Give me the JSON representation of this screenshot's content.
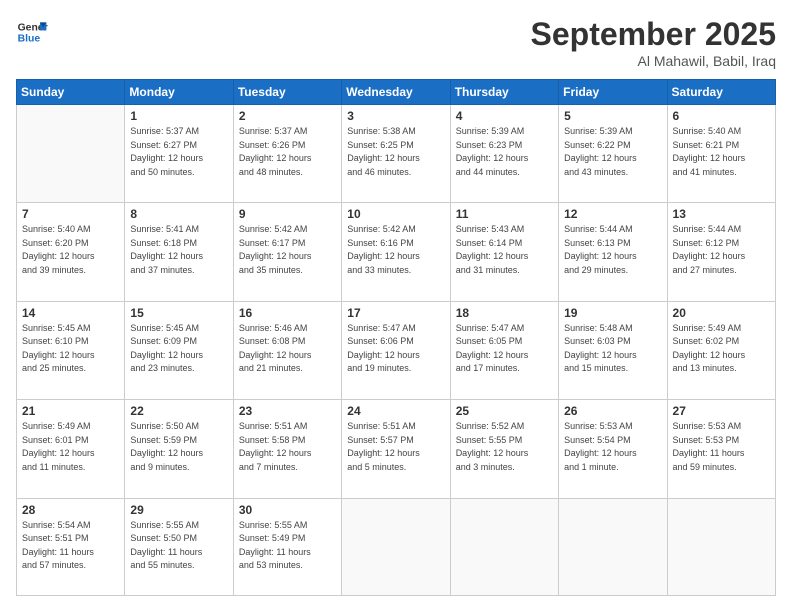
{
  "header": {
    "logo_line1": "General",
    "logo_line2": "Blue",
    "month_year": "September 2025",
    "location": "Al Mahawil, Babil, Iraq"
  },
  "weekdays": [
    "Sunday",
    "Monday",
    "Tuesday",
    "Wednesday",
    "Thursday",
    "Friday",
    "Saturday"
  ],
  "rows": [
    [
      {
        "day": "",
        "info": ""
      },
      {
        "day": "1",
        "info": "Sunrise: 5:37 AM\nSunset: 6:27 PM\nDaylight: 12 hours\nand 50 minutes."
      },
      {
        "day": "2",
        "info": "Sunrise: 5:37 AM\nSunset: 6:26 PM\nDaylight: 12 hours\nand 48 minutes."
      },
      {
        "day": "3",
        "info": "Sunrise: 5:38 AM\nSunset: 6:25 PM\nDaylight: 12 hours\nand 46 minutes."
      },
      {
        "day": "4",
        "info": "Sunrise: 5:39 AM\nSunset: 6:23 PM\nDaylight: 12 hours\nand 44 minutes."
      },
      {
        "day": "5",
        "info": "Sunrise: 5:39 AM\nSunset: 6:22 PM\nDaylight: 12 hours\nand 43 minutes."
      },
      {
        "day": "6",
        "info": "Sunrise: 5:40 AM\nSunset: 6:21 PM\nDaylight: 12 hours\nand 41 minutes."
      }
    ],
    [
      {
        "day": "7",
        "info": "Sunrise: 5:40 AM\nSunset: 6:20 PM\nDaylight: 12 hours\nand 39 minutes."
      },
      {
        "day": "8",
        "info": "Sunrise: 5:41 AM\nSunset: 6:18 PM\nDaylight: 12 hours\nand 37 minutes."
      },
      {
        "day": "9",
        "info": "Sunrise: 5:42 AM\nSunset: 6:17 PM\nDaylight: 12 hours\nand 35 minutes."
      },
      {
        "day": "10",
        "info": "Sunrise: 5:42 AM\nSunset: 6:16 PM\nDaylight: 12 hours\nand 33 minutes."
      },
      {
        "day": "11",
        "info": "Sunrise: 5:43 AM\nSunset: 6:14 PM\nDaylight: 12 hours\nand 31 minutes."
      },
      {
        "day": "12",
        "info": "Sunrise: 5:44 AM\nSunset: 6:13 PM\nDaylight: 12 hours\nand 29 minutes."
      },
      {
        "day": "13",
        "info": "Sunrise: 5:44 AM\nSunset: 6:12 PM\nDaylight: 12 hours\nand 27 minutes."
      }
    ],
    [
      {
        "day": "14",
        "info": "Sunrise: 5:45 AM\nSunset: 6:10 PM\nDaylight: 12 hours\nand 25 minutes."
      },
      {
        "day": "15",
        "info": "Sunrise: 5:45 AM\nSunset: 6:09 PM\nDaylight: 12 hours\nand 23 minutes."
      },
      {
        "day": "16",
        "info": "Sunrise: 5:46 AM\nSunset: 6:08 PM\nDaylight: 12 hours\nand 21 minutes."
      },
      {
        "day": "17",
        "info": "Sunrise: 5:47 AM\nSunset: 6:06 PM\nDaylight: 12 hours\nand 19 minutes."
      },
      {
        "day": "18",
        "info": "Sunrise: 5:47 AM\nSunset: 6:05 PM\nDaylight: 12 hours\nand 17 minutes."
      },
      {
        "day": "19",
        "info": "Sunrise: 5:48 AM\nSunset: 6:03 PM\nDaylight: 12 hours\nand 15 minutes."
      },
      {
        "day": "20",
        "info": "Sunrise: 5:49 AM\nSunset: 6:02 PM\nDaylight: 12 hours\nand 13 minutes."
      }
    ],
    [
      {
        "day": "21",
        "info": "Sunrise: 5:49 AM\nSunset: 6:01 PM\nDaylight: 12 hours\nand 11 minutes."
      },
      {
        "day": "22",
        "info": "Sunrise: 5:50 AM\nSunset: 5:59 PM\nDaylight: 12 hours\nand 9 minutes."
      },
      {
        "day": "23",
        "info": "Sunrise: 5:51 AM\nSunset: 5:58 PM\nDaylight: 12 hours\nand 7 minutes."
      },
      {
        "day": "24",
        "info": "Sunrise: 5:51 AM\nSunset: 5:57 PM\nDaylight: 12 hours\nand 5 minutes."
      },
      {
        "day": "25",
        "info": "Sunrise: 5:52 AM\nSunset: 5:55 PM\nDaylight: 12 hours\nand 3 minutes."
      },
      {
        "day": "26",
        "info": "Sunrise: 5:53 AM\nSunset: 5:54 PM\nDaylight: 12 hours\nand 1 minute."
      },
      {
        "day": "27",
        "info": "Sunrise: 5:53 AM\nSunset: 5:53 PM\nDaylight: 11 hours\nand 59 minutes."
      }
    ],
    [
      {
        "day": "28",
        "info": "Sunrise: 5:54 AM\nSunset: 5:51 PM\nDaylight: 11 hours\nand 57 minutes."
      },
      {
        "day": "29",
        "info": "Sunrise: 5:55 AM\nSunset: 5:50 PM\nDaylight: 11 hours\nand 55 minutes."
      },
      {
        "day": "30",
        "info": "Sunrise: 5:55 AM\nSunset: 5:49 PM\nDaylight: 11 hours\nand 53 minutes."
      },
      {
        "day": "",
        "info": ""
      },
      {
        "day": "",
        "info": ""
      },
      {
        "day": "",
        "info": ""
      },
      {
        "day": "",
        "info": ""
      }
    ]
  ]
}
